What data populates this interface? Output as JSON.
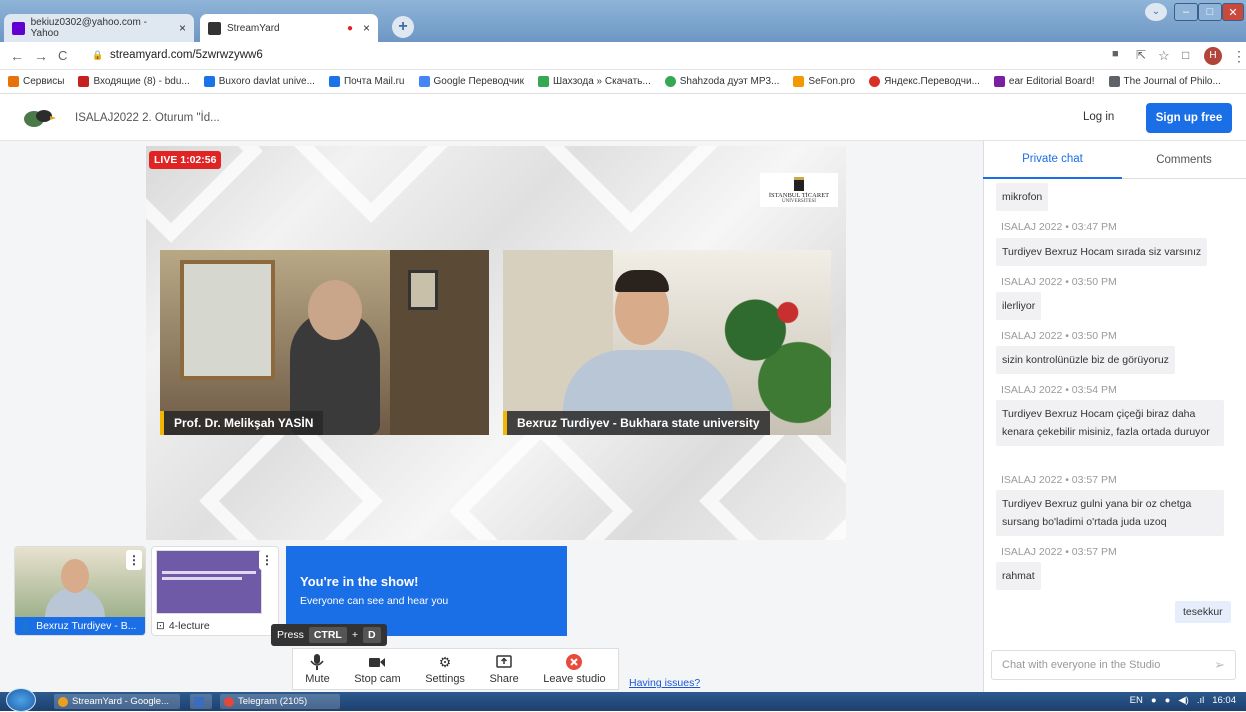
{
  "browser": {
    "tabs": [
      {
        "title": "bekiuz0302@yahoo.com - Yahoo",
        "close": "×"
      },
      {
        "title": "StreamYard",
        "close": "×"
      }
    ],
    "new_tab": "+",
    "url": "streamyard.com/5zwrwzyww6",
    "window_buttons": {
      "minimize": "–",
      "maximize": "□",
      "close": "✕"
    }
  },
  "bookmarks": [
    {
      "label": "Сервисы",
      "color": "#e8710a"
    },
    {
      "label": "Входящие (8) - bdu...",
      "color": "#c5221f"
    },
    {
      "label": "Buxoro davlat unive...",
      "color": "#1a73e8"
    },
    {
      "label": "Почта Mail.ru",
      "color": "#1a73e8"
    },
    {
      "label": "Google Переводчик",
      "color": "#4285f4"
    },
    {
      "label": "Шахзода » Скачать...",
      "color": "#34a853"
    },
    {
      "label": "Shahzoda дуэт MP3...",
      "color": "#34a853"
    },
    {
      "label": "SeFon.pro",
      "color": "#f29900"
    },
    {
      "label": "Яндекс.Переводчи...",
      "color": "#d93025"
    },
    {
      "label": "ear Editorial Board!",
      "color": "#7b1fa2"
    },
    {
      "label": "The Journal of Philo...",
      "color": "#5f6368"
    }
  ],
  "header": {
    "title": "ISALAJ2022 2. Oturum \"İd...",
    "login": "Log in",
    "signup": "Sign up free"
  },
  "stage": {
    "live": "LIVE 1:02:56",
    "logo_line1": "İSTANBUL TİCARET",
    "logo_line2": "ÜNİVERSİTESİ",
    "participants": [
      {
        "name": "Prof. Dr. Melikşah YASİN"
      },
      {
        "name": "Bexruz Turdiyev - Bukhara state university"
      }
    ]
  },
  "strip": {
    "thumb1_label": "Bexruz Turdiyev - B...",
    "thumb2_label": "4-lecture",
    "show_title": "You're in the show!",
    "show_sub": "Everyone can see and hear you",
    "tooltip_press": "Press",
    "tooltip_ctrl": "CTRL",
    "tooltip_plus": "+",
    "tooltip_key": "D"
  },
  "controls": [
    {
      "label": "Mute",
      "icon": "mic-icon",
      "glyph": "🎤"
    },
    {
      "label": "Stop cam",
      "icon": "camera-icon",
      "glyph": "■"
    },
    {
      "label": "Settings",
      "icon": "gear-icon",
      "glyph": "⚙"
    },
    {
      "label": "Share",
      "icon": "share-screen-icon",
      "glyph": "⊞"
    },
    {
      "label": "Leave studio",
      "icon": "leave-icon",
      "glyph": "✕"
    }
  ],
  "having_issues": "Having issues?",
  "chat": {
    "tabs": [
      "Private chat",
      "Comments"
    ],
    "messages": [
      {
        "header": "",
        "text": "mikrofon"
      },
      {
        "header": "ISALAJ 2022 • 03:47 PM",
        "text": "Turdiyev Bexruz Hocam sırada siz varsınız"
      },
      {
        "header": "ISALAJ 2022 • 03:50 PM",
        "text": "ilerliyor"
      },
      {
        "header": "ISALAJ 2022 • 03:50 PM",
        "text": "sizin kontrolünüzle biz de görüyoruz"
      },
      {
        "header": "ISALAJ 2022 • 03:54 PM",
        "text": "Turdiyev Bexruz Hocam çiçeği biraz daha kenara çekebilir misiniz, fazla ortada duruyor"
      },
      {
        "header": "ISALAJ 2022 • 03:57 PM",
        "text": "Turdiyev Bexruz gulni yana bir oz chetga sursang bo'ladimi o'rtada juda uzoq"
      },
      {
        "header": "ISALAJ 2022 • 03:57 PM",
        "text": "rahmat"
      }
    ],
    "own_message": "tesekkur",
    "input_placeholder": "Chat with everyone in the Studio",
    "send": "➢"
  },
  "taskbar": {
    "items": [
      "StreamYard - Google...",
      "",
      "Telegram (2105)"
    ],
    "lang": "EN",
    "time": "16:04"
  }
}
